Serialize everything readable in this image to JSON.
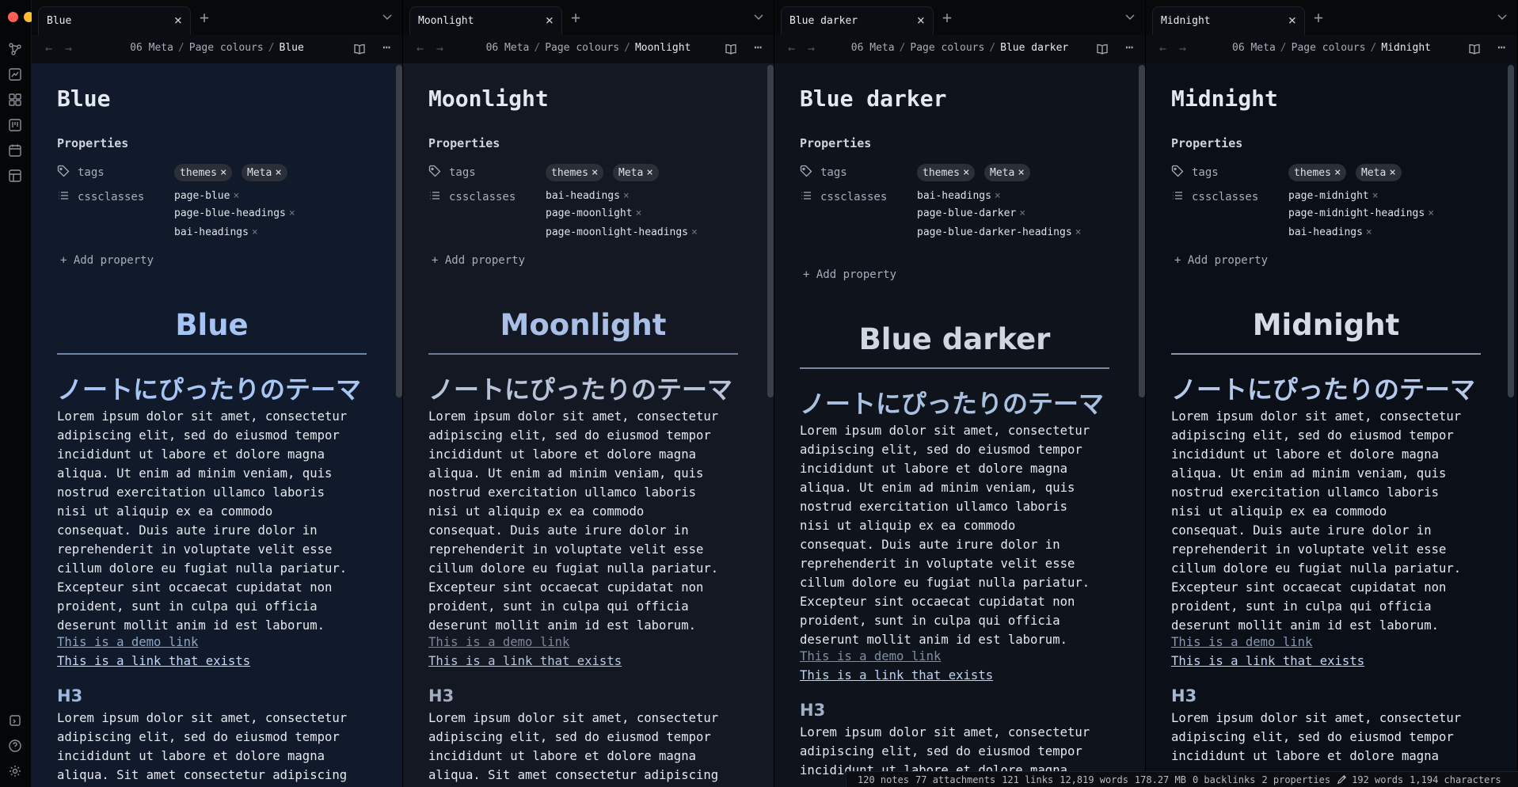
{
  "app": {
    "breadcrumb_folder": "06 Meta",
    "breadcrumb_subfolder": "Page colours",
    "separator": "/",
    "properties_heading": "Properties",
    "add_property": "Add property",
    "tags_key": "tags",
    "cssclasses_key": "cssclasses",
    "tag_remove": "×"
  },
  "ribbon": {
    "icons": [
      "graph-icon",
      "canvas-icon",
      "plugins-icon",
      "kanban-icon",
      "calendar-icon",
      "templates-icon"
    ],
    "bottom_icons": [
      "vault-icon",
      "help-icon",
      "settings-icon"
    ]
  },
  "panes": [
    {
      "tab_title": "Blue",
      "note_title": "Blue",
      "tags": [
        "themes",
        "Meta"
      ],
      "cssclasses": [
        "page-blue",
        "page-blue-headings",
        "bai-headings"
      ],
      "h1": "Blue",
      "h2": "ノートにぴったりのテーマ",
      "para1": "Lorem ipsum dolor sit amet, consectetur\nadipiscing elit, sed do eiusmod tempor\nincididunt ut labore et dolore magna\naliqua. Ut enim ad minim veniam, quis\nnostrud exercitation ullamco laboris\nnisi ut aliquip ex ea commodo\nconsequat. Duis aute irure dolor in\nreprehenderit in voluptate velit esse\ncillum dolore eu fugiat nulla pariatur.\nExcepteur sint occaecat cupidatat non\nproident, sunt in culpa qui officia\ndeserunt mollit anim id est laborum.",
      "link_demo": "This is a demo link",
      "link_exists": "This is a link that exists",
      "h3": "H3",
      "para2": "Lorem ipsum dolor sit amet, consectetur\nadipiscing elit, sed do eiusmod tempor\nincididunt ut labore et dolore magna\naliqua. Sit amet consectetur adipiscing",
      "colors": {
        "bg": "#111a2a",
        "h1": "#a5c3f3",
        "h2": "#a8c6f5",
        "rule": "#6c85a8",
        "link_demo": "#8fa5c6",
        "link_exists": "#c3d8fb",
        "h3": "#9fb8e0"
      }
    },
    {
      "tab_title": "Moonlight",
      "note_title": "Moonlight",
      "tags": [
        "themes",
        "Meta"
      ],
      "cssclasses": [
        "bai-headings",
        "page-moonlight",
        "page-moonlight-headings"
      ],
      "h1": "Moonlight",
      "h2": "ノートにぴったりのテーマ",
      "para1": "Lorem ipsum dolor sit amet, consectetur\nadipiscing elit, sed do eiusmod tempor\nincididunt ut labore et dolore magna\naliqua. Ut enim ad minim veniam, quis\nnostrud exercitation ullamco laboris\nnisi ut aliquip ex ea commodo\nconsequat. Duis aute irure dolor in\nreprehenderit in voluptate velit esse\ncillum dolore eu fugiat nulla pariatur.\nExcepteur sint occaecat cupidatat non\nproident, sunt in culpa qui officia\ndeserunt mollit anim id est laborum.",
      "link_demo": "This is a demo link",
      "link_exists": "This is a link that exists",
      "h3": "H3",
      "para2": "Lorem ipsum dolor sit amet, consectetur\nadipiscing elit, sed do eiusmod tempor\nincididunt ut labore et dolore magna\naliqua. Sit amet consectetur adipiscing",
      "colors": {
        "bg": "#131823",
        "h1": "#a9bfe6",
        "h2": "#b7c3d9",
        "rule": "#6f7b91",
        "link_demo": "#7e8596",
        "link_exists": "#b9c6de",
        "h3": "#a4adbf"
      }
    },
    {
      "tab_title": "Blue darker",
      "note_title": "Blue darker",
      "tags": [
        "themes",
        "Meta"
      ],
      "cssclasses": [
        "bai-headings",
        "page-blue-darker",
        "page-blue-darker-headings"
      ],
      "h1": "Blue darker",
      "h2": "ノートにぴったりのテーマ",
      "para1": "Lorem ipsum dolor sit amet, consectetur\nadipiscing elit, sed do eiusmod tempor\nincididunt ut labore et dolore magna\naliqua. Ut enim ad minim veniam, quis\nnostrud exercitation ullamco laboris\nnisi ut aliquip ex ea commodo\nconsequat. Duis aute irure dolor in\nreprehenderit in voluptate velit esse\ncillum dolore eu fugiat nulla pariatur.\nExcepteur sint occaecat cupidatat non\nproident, sunt in culpa qui officia\ndeserunt mollit anim id est laborum.",
      "link_demo": "This is a demo link",
      "link_exists": "This is a link that exists",
      "h3": "H3",
      "para2": "Lorem ipsum dolor sit amet, consectetur\nadipiscing elit, sed do eiusmod tempor\nincididunt ut labore et dolore magna",
      "colors": {
        "bg": "#0e131c",
        "h1": "#d0d6e0",
        "h2": "#a9c0e0",
        "rule": "#7b879a",
        "link_demo": "#7f8ea6",
        "link_exists": "#bcd3f4",
        "h3": "#9fb0c9"
      }
    },
    {
      "tab_title": "Midnight",
      "note_title": "Midnight",
      "tags": [
        "themes",
        "Meta"
      ],
      "cssclasses": [
        "page-midnight",
        "page-midnight-headings",
        "bai-headings"
      ],
      "h1": "Midnight",
      "h2": "ノートにぴったりのテーマ",
      "para1": "Lorem ipsum dolor sit amet, consectetur\nadipiscing elit, sed do eiusmod tempor\nincididunt ut labore et dolore magna\naliqua. Ut enim ad minim veniam, quis\nnostrud exercitation ullamco laboris\nnisi ut aliquip ex ea commodo\nconsequat. Duis aute irure dolor in\nreprehenderit in voluptate velit esse\ncillum dolore eu fugiat nulla pariatur.\nExcepteur sint occaecat cupidatat non\nproident, sunt in culpa qui officia\ndeserunt mollit anim id est laborum.",
      "link_demo": "This is a demo link",
      "link_exists": "This is a link that exists",
      "h3": "H3",
      "para2": "Lorem ipsum dolor sit amet, consectetur\nadipiscing elit, sed do eiusmod tempor\nincididunt ut labore et dolore magna",
      "colors": {
        "bg": "#0b0f17",
        "h1": "#d6dbe6",
        "h2": "#b4c9ec",
        "rule": "#8c95a6",
        "link_demo": "#8797b1",
        "link_exists": "#c0d4f4",
        "h3": "#a7b8d2"
      }
    }
  ],
  "status_bar": {
    "notes": "120 notes",
    "attachments": "77 attachments",
    "links": "121 links",
    "words_total": "12,819 words",
    "size": "178.27 MB",
    "backlinks": "0 backlinks",
    "properties": "2 properties",
    "words": "192 words",
    "characters": "1,194 characters"
  }
}
